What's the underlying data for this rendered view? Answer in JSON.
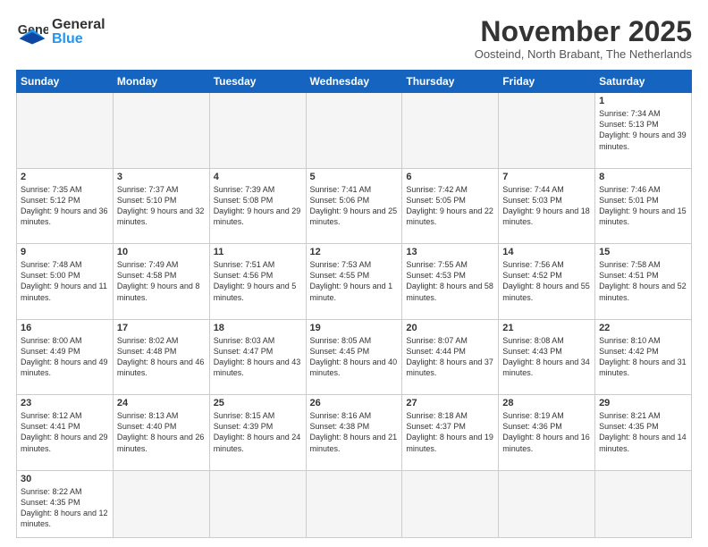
{
  "logo": {
    "text_general": "General",
    "text_blue": "Blue"
  },
  "header": {
    "month_year": "November 2025",
    "location": "Oosteind, North Brabant, The Netherlands"
  },
  "weekdays": [
    "Sunday",
    "Monday",
    "Tuesday",
    "Wednesday",
    "Thursday",
    "Friday",
    "Saturday"
  ],
  "weeks": [
    [
      {
        "day": "",
        "info": ""
      },
      {
        "day": "",
        "info": ""
      },
      {
        "day": "",
        "info": ""
      },
      {
        "day": "",
        "info": ""
      },
      {
        "day": "",
        "info": ""
      },
      {
        "day": "",
        "info": ""
      },
      {
        "day": "1",
        "info": "Sunrise: 7:34 AM\nSunset: 5:13 PM\nDaylight: 9 hours\nand 39 minutes."
      }
    ],
    [
      {
        "day": "2",
        "info": "Sunrise: 7:35 AM\nSunset: 5:12 PM\nDaylight: 9 hours\nand 36 minutes."
      },
      {
        "day": "3",
        "info": "Sunrise: 7:37 AM\nSunset: 5:10 PM\nDaylight: 9 hours\nand 32 minutes."
      },
      {
        "day": "4",
        "info": "Sunrise: 7:39 AM\nSunset: 5:08 PM\nDaylight: 9 hours\nand 29 minutes."
      },
      {
        "day": "5",
        "info": "Sunrise: 7:41 AM\nSunset: 5:06 PM\nDaylight: 9 hours\nand 25 minutes."
      },
      {
        "day": "6",
        "info": "Sunrise: 7:42 AM\nSunset: 5:05 PM\nDaylight: 9 hours\nand 22 minutes."
      },
      {
        "day": "7",
        "info": "Sunrise: 7:44 AM\nSunset: 5:03 PM\nDaylight: 9 hours\nand 18 minutes."
      },
      {
        "day": "8",
        "info": "Sunrise: 7:46 AM\nSunset: 5:01 PM\nDaylight: 9 hours\nand 15 minutes."
      }
    ],
    [
      {
        "day": "9",
        "info": "Sunrise: 7:48 AM\nSunset: 5:00 PM\nDaylight: 9 hours\nand 11 minutes."
      },
      {
        "day": "10",
        "info": "Sunrise: 7:49 AM\nSunset: 4:58 PM\nDaylight: 9 hours\nand 8 minutes."
      },
      {
        "day": "11",
        "info": "Sunrise: 7:51 AM\nSunset: 4:56 PM\nDaylight: 9 hours\nand 5 minutes."
      },
      {
        "day": "12",
        "info": "Sunrise: 7:53 AM\nSunset: 4:55 PM\nDaylight: 9 hours\nand 1 minute."
      },
      {
        "day": "13",
        "info": "Sunrise: 7:55 AM\nSunset: 4:53 PM\nDaylight: 8 hours\nand 58 minutes."
      },
      {
        "day": "14",
        "info": "Sunrise: 7:56 AM\nSunset: 4:52 PM\nDaylight: 8 hours\nand 55 minutes."
      },
      {
        "day": "15",
        "info": "Sunrise: 7:58 AM\nSunset: 4:51 PM\nDaylight: 8 hours\nand 52 minutes."
      }
    ],
    [
      {
        "day": "16",
        "info": "Sunrise: 8:00 AM\nSunset: 4:49 PM\nDaylight: 8 hours\nand 49 minutes."
      },
      {
        "day": "17",
        "info": "Sunrise: 8:02 AM\nSunset: 4:48 PM\nDaylight: 8 hours\nand 46 minutes."
      },
      {
        "day": "18",
        "info": "Sunrise: 8:03 AM\nSunset: 4:47 PM\nDaylight: 8 hours\nand 43 minutes."
      },
      {
        "day": "19",
        "info": "Sunrise: 8:05 AM\nSunset: 4:45 PM\nDaylight: 8 hours\nand 40 minutes."
      },
      {
        "day": "20",
        "info": "Sunrise: 8:07 AM\nSunset: 4:44 PM\nDaylight: 8 hours\nand 37 minutes."
      },
      {
        "day": "21",
        "info": "Sunrise: 8:08 AM\nSunset: 4:43 PM\nDaylight: 8 hours\nand 34 minutes."
      },
      {
        "day": "22",
        "info": "Sunrise: 8:10 AM\nSunset: 4:42 PM\nDaylight: 8 hours\nand 31 minutes."
      }
    ],
    [
      {
        "day": "23",
        "info": "Sunrise: 8:12 AM\nSunset: 4:41 PM\nDaylight: 8 hours\nand 29 minutes."
      },
      {
        "day": "24",
        "info": "Sunrise: 8:13 AM\nSunset: 4:40 PM\nDaylight: 8 hours\nand 26 minutes."
      },
      {
        "day": "25",
        "info": "Sunrise: 8:15 AM\nSunset: 4:39 PM\nDaylight: 8 hours\nand 24 minutes."
      },
      {
        "day": "26",
        "info": "Sunrise: 8:16 AM\nSunset: 4:38 PM\nDaylight: 8 hours\nand 21 minutes."
      },
      {
        "day": "27",
        "info": "Sunrise: 8:18 AM\nSunset: 4:37 PM\nDaylight: 8 hours\nand 19 minutes."
      },
      {
        "day": "28",
        "info": "Sunrise: 8:19 AM\nSunset: 4:36 PM\nDaylight: 8 hours\nand 16 minutes."
      },
      {
        "day": "29",
        "info": "Sunrise: 8:21 AM\nSunset: 4:35 PM\nDaylight: 8 hours\nand 14 minutes."
      }
    ],
    [
      {
        "day": "30",
        "info": "Sunrise: 8:22 AM\nSunset: 4:35 PM\nDaylight: 8 hours\nand 12 minutes."
      },
      {
        "day": "",
        "info": ""
      },
      {
        "day": "",
        "info": ""
      },
      {
        "day": "",
        "info": ""
      },
      {
        "day": "",
        "info": ""
      },
      {
        "day": "",
        "info": ""
      },
      {
        "day": "",
        "info": ""
      }
    ]
  ]
}
